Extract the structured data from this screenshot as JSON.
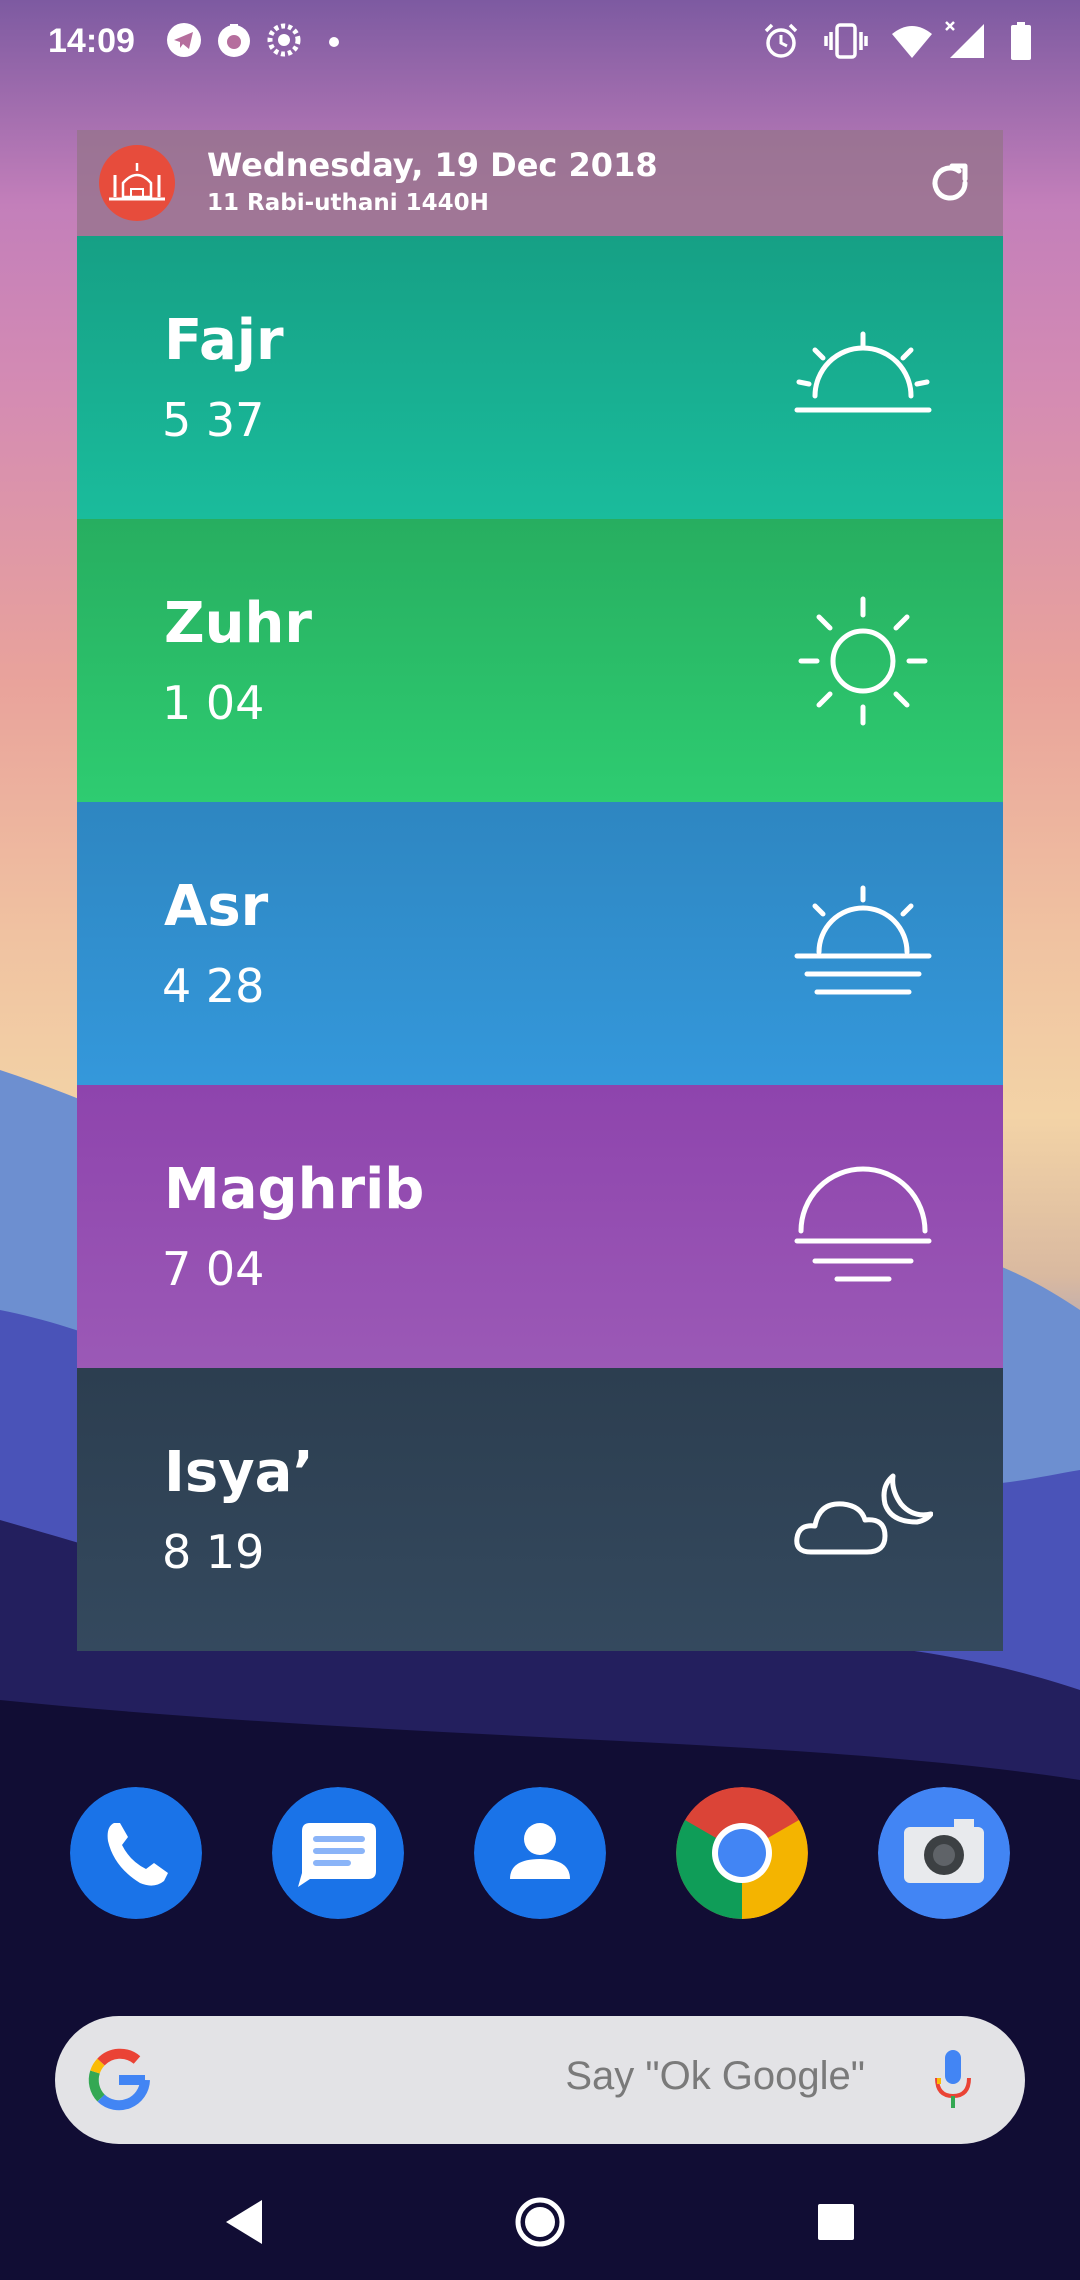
{
  "status_bar": {
    "time": "14:09",
    "left_icons": [
      "telegram-icon",
      "app-notification-icon",
      "settings-notification-icon",
      "dot-icon"
    ],
    "right_icons": [
      "alarm-icon",
      "vibrate-icon",
      "wifi-icon",
      "cell-signal-icon",
      "battery-icon"
    ]
  },
  "widget": {
    "gregorian_date": "Wednesday, 19 Dec 2018",
    "hijri_date": "11 Rabi-uthani 1440H",
    "header_bg": "#a07a93",
    "prayers": [
      {
        "name": "Fajr",
        "time": "5 37",
        "color": "#1bab8c",
        "icon": "sunrise-icon"
      },
      {
        "name": "Zuhr",
        "time": "1 04",
        "color": "#2ebf67",
        "icon": "sun-icon"
      },
      {
        "name": "Asr",
        "time": "4 28",
        "color": "#3191d6",
        "icon": "sun-haze-icon"
      },
      {
        "name": "Maghrib",
        "time": "7 04",
        "color": "#9451b2",
        "icon": "sunset-icon"
      },
      {
        "name": "Isya’",
        "time": "8 19",
        "color": "#334557",
        "icon": "cloud-moon-icon"
      }
    ]
  },
  "dock": {
    "apps": [
      "phone-icon",
      "messages-icon",
      "contacts-icon",
      "chrome-icon",
      "camera-icon"
    ]
  },
  "search": {
    "hint": "Say \"Ok Google\""
  },
  "nav": {
    "buttons": [
      "back-button",
      "home-button",
      "recents-button"
    ]
  }
}
